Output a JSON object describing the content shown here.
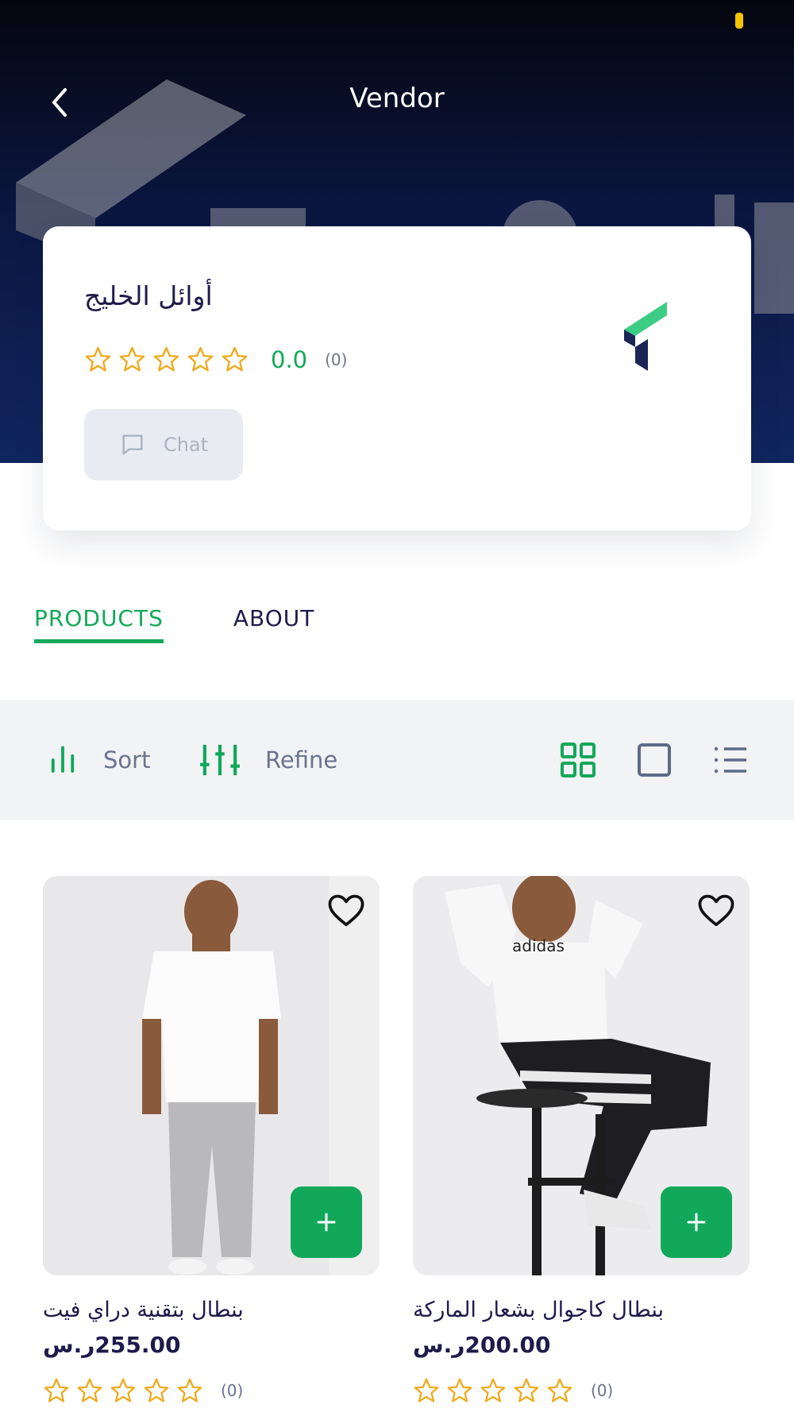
{
  "header": {
    "title": "Vendor",
    "back_icon": "chevron-left-icon"
  },
  "vendor": {
    "name": "أوائل الخليج",
    "rating_value": "0.0",
    "rating_count": "(0)",
    "stars": 5,
    "chat_label": "Chat",
    "logo_colors": {
      "green": "#3dcc84",
      "navy": "#1b2656"
    }
  },
  "tabs": [
    {
      "label": "PRODUCTS",
      "active": true
    },
    {
      "label": "ABOUT",
      "active": false
    }
  ],
  "toolbar": {
    "sort_label": "Sort",
    "refine_label": "Refine",
    "views": [
      "grid-view-icon",
      "single-view-icon",
      "list-view-icon"
    ],
    "active_view": "grid-view-icon"
  },
  "products": [
    {
      "name": "بنطال بتقنية دراي فيت",
      "price": "255.00ر.س",
      "rating_count": "(0)"
    },
    {
      "name": "بنطال كاجوال بشعار الماركة",
      "price": "200.00ر.س",
      "rating_count": "(0)"
    }
  ],
  "colors": {
    "accent_green": "#12a85a",
    "navy_text": "#1e1b4b",
    "star_yellow": "#f0a91a",
    "header_dark": "#0b1640"
  }
}
